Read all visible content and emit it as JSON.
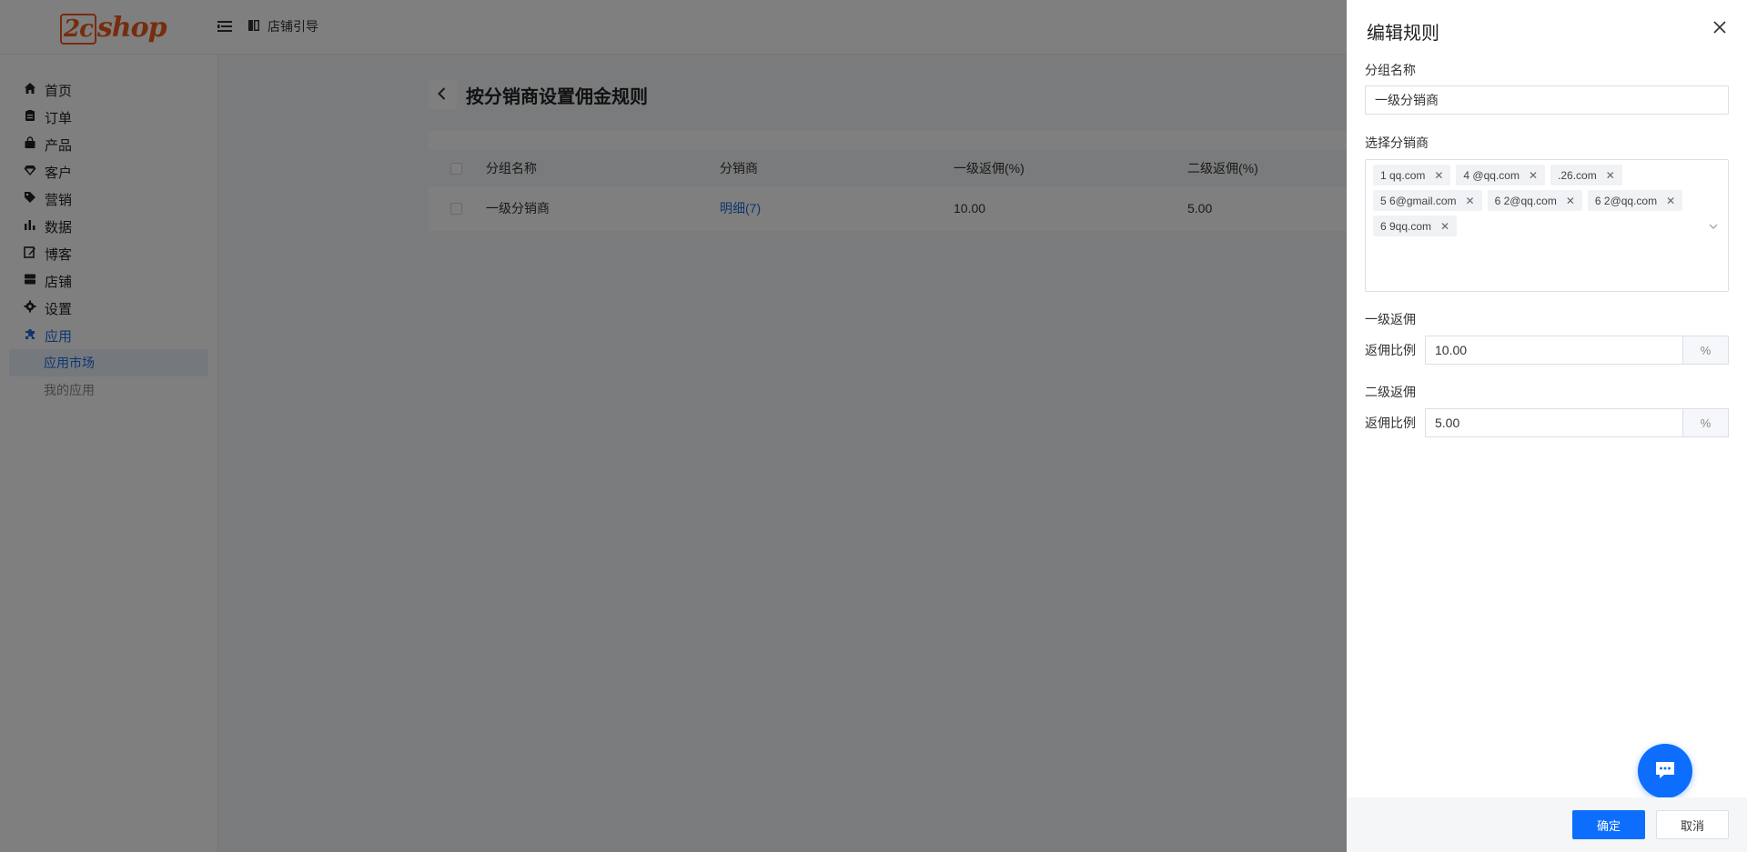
{
  "header": {
    "logo_text": "shop",
    "logo_prefix": "2c",
    "breadcrumb_label": "店铺引导"
  },
  "sidebar": {
    "items": [
      {
        "label": "首页",
        "icon": "home-icon"
      },
      {
        "label": "订单",
        "icon": "clipboard-icon"
      },
      {
        "label": "产品",
        "icon": "bag-icon"
      },
      {
        "label": "客户",
        "icon": "diamond-icon"
      },
      {
        "label": "营销",
        "icon": "tag-icon"
      },
      {
        "label": "数据",
        "icon": "bar-chart-icon"
      },
      {
        "label": "博客",
        "icon": "edit-icon"
      },
      {
        "label": "店铺",
        "icon": "store-icon"
      },
      {
        "label": "设置",
        "icon": "gear-icon"
      },
      {
        "label": "应用",
        "icon": "puzzle-icon"
      }
    ],
    "sub_items": [
      {
        "label": "应用市场"
      },
      {
        "label": "我的应用"
      }
    ]
  },
  "main": {
    "title": "按分销商设置佣金规则",
    "columns": [
      "分组名称",
      "分销商",
      "一级返佣(%)",
      "二级返佣(%)"
    ],
    "rows": [
      {
        "name": "一级分销商",
        "detail": "明细(7)",
        "level1": "10.00",
        "level2": "5.00"
      }
    ]
  },
  "drawer": {
    "title": "编辑规则",
    "group_name_label": "分组名称",
    "group_name_value": "一级分销商",
    "distributor_label": "选择分销商",
    "tags": [
      "1      qq.com",
      "4      @qq.com",
      "      .26.com",
      "5    6@gmail.com",
      "6      2@qq.com",
      "6      2@qq.com",
      "6     9qq.com"
    ],
    "level1_label": "一级返佣",
    "level1_rate_label": "返佣比例",
    "level1_value": "10.00",
    "level2_label": "二级返佣",
    "level2_rate_label": "返佣比例",
    "level2_value": "5.00",
    "percent_suffix": "%",
    "confirm_label": "确定",
    "cancel_label": "取消"
  },
  "colors": {
    "primary": "#0d6efd",
    "link": "#1d6de0",
    "logo": "#ec5a1c"
  }
}
